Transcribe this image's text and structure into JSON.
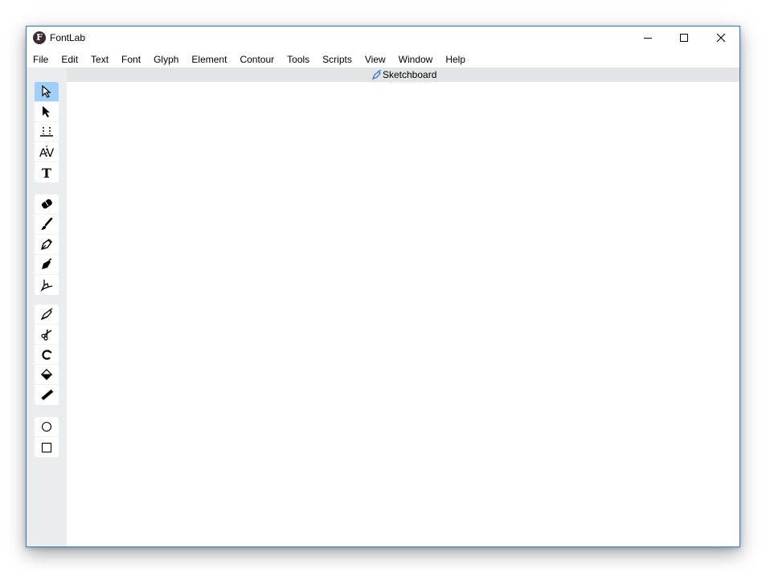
{
  "window": {
    "title": "FontLab",
    "logo_letter": "F",
    "controls": [
      "minimize",
      "maximize",
      "close"
    ]
  },
  "menubar": {
    "items": [
      "File",
      "Edit",
      "Text",
      "Font",
      "Glyph",
      "Element",
      "Contour",
      "Tools",
      "Scripts",
      "View",
      "Window",
      "Help"
    ]
  },
  "tab": {
    "label": "Sketchboard",
    "icon": "pen-icon"
  },
  "toolbar": {
    "groups": [
      [
        "contour-select-tool",
        "element-select-tool",
        "metrics-tool",
        "kerning-tool",
        "text-tool"
      ],
      [
        "eraser-tool",
        "brush-tool",
        "pencil-tool",
        "pen-tool",
        "rapidograph-tool"
      ],
      [
        "knife-tool",
        "scissors-tool",
        "magnet-tool",
        "fill-tool",
        "ruler-tool"
      ],
      [
        "ellipse-tool",
        "rectangle-tool"
      ]
    ],
    "active": "contour-select-tool"
  }
}
